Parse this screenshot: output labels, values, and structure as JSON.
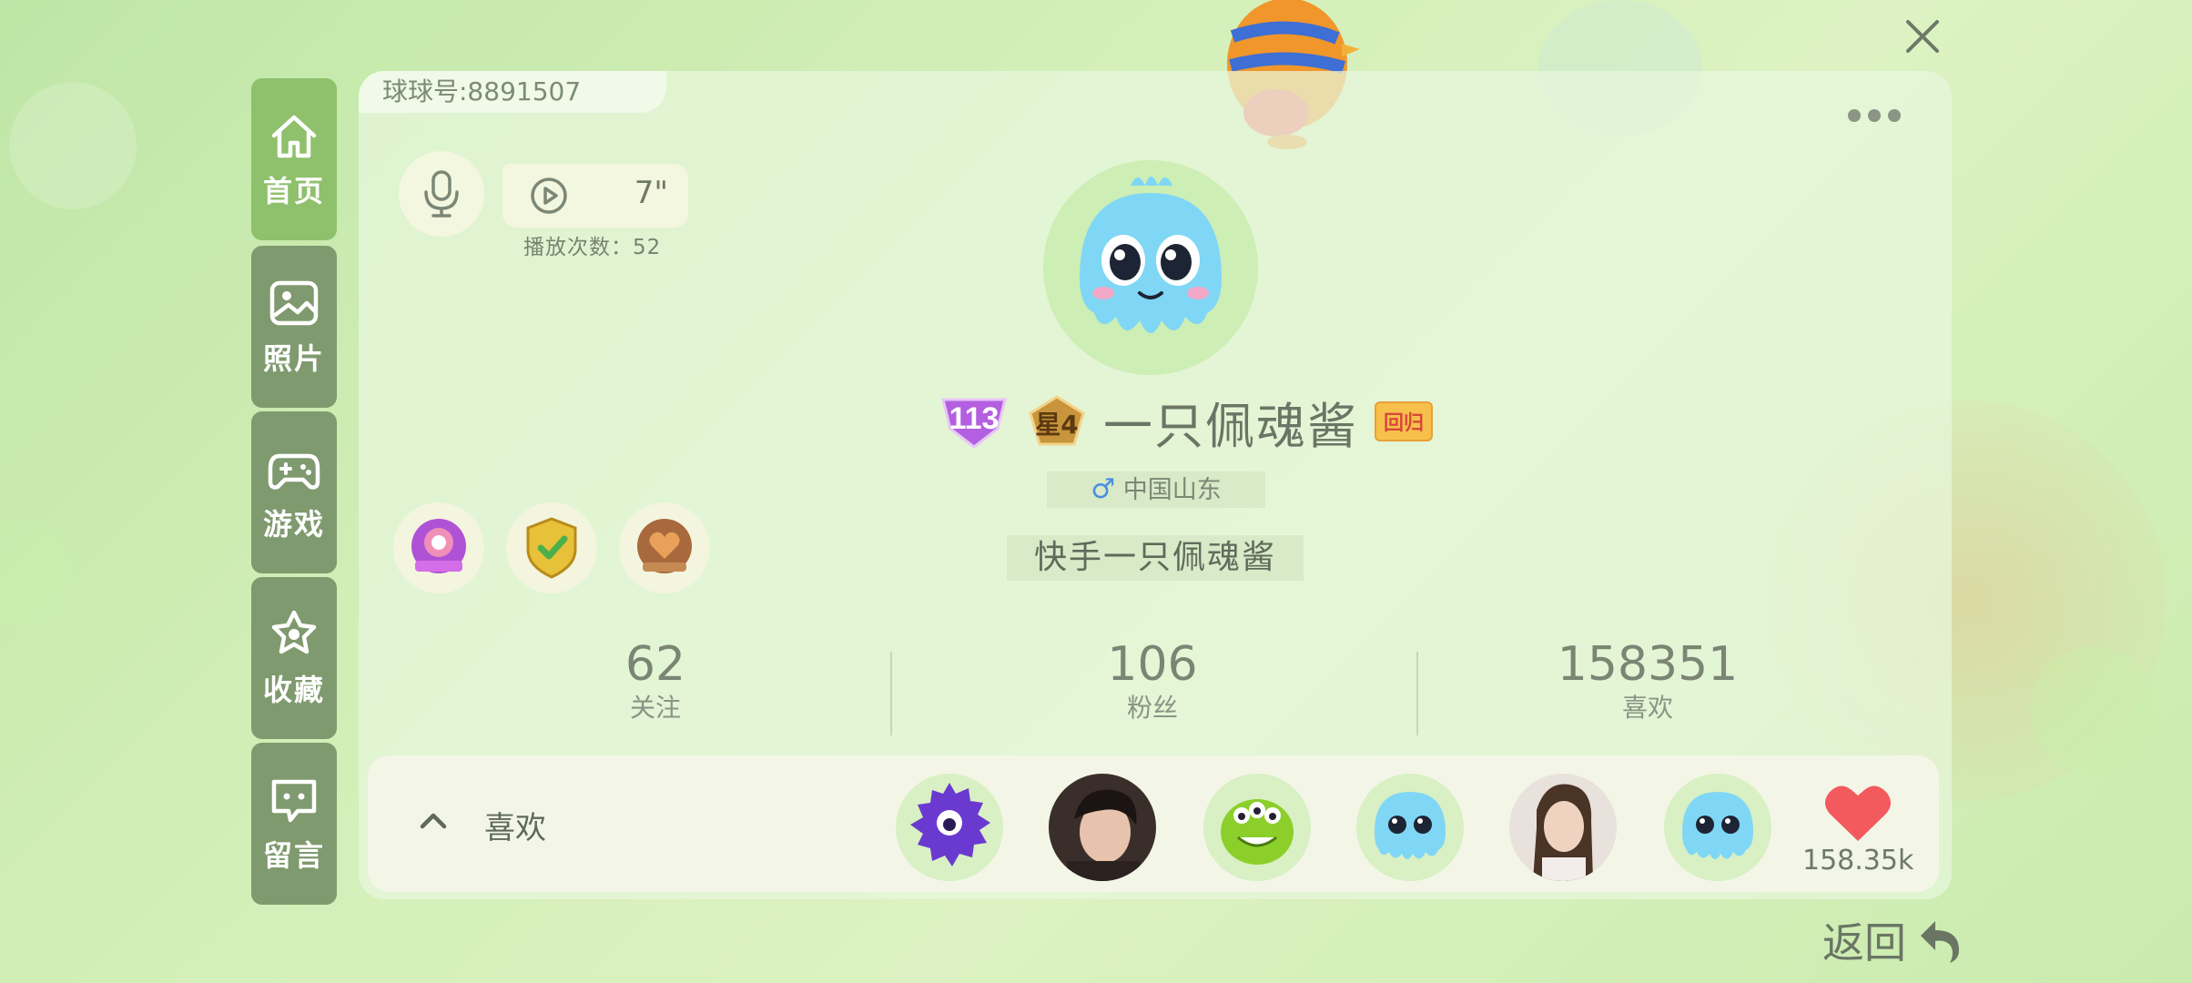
{
  "profile": {
    "id_label": "球球号:8891507",
    "level": "113",
    "star_badge": "星4",
    "username": "一只佩魂酱",
    "return_badge": "回归",
    "gender_symbol": "♂",
    "location": "中国山东",
    "signature": "快手一只佩魂酱"
  },
  "voice": {
    "duration": "7\"",
    "play_count": "播放次数：52"
  },
  "nav": {
    "items": [
      {
        "label": "首页",
        "icon": "home-icon"
      },
      {
        "label": "照片",
        "icon": "photo-icon"
      },
      {
        "label": "游戏",
        "icon": "gamepad-icon"
      },
      {
        "label": "收藏",
        "icon": "star-icon"
      },
      {
        "label": "留言",
        "icon": "message-icon"
      }
    ]
  },
  "stats": {
    "following": {
      "value": "62",
      "label": "关注"
    },
    "fans": {
      "value": "106",
      "label": "粉丝"
    },
    "likes": {
      "value": "158351",
      "label": "喜欢"
    }
  },
  "likes_bar": {
    "label": "喜欢",
    "count": "158.35k"
  },
  "footer": {
    "back_label": "返回"
  },
  "colors": {
    "accent_green": "#8fc06c",
    "nav_bg": "#7f9a6e",
    "heart": "#f35a5e"
  }
}
